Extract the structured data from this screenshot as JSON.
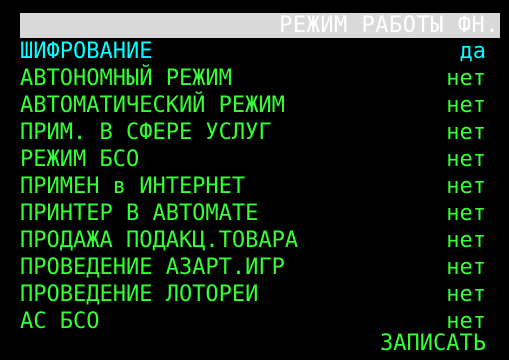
{
  "header": {
    "title": "РЕЖИМ РАБОТЫ ФН."
  },
  "menu": {
    "items": [
      {
        "label": "ШИФРОВАНИЕ",
        "value": "да",
        "selected": true
      },
      {
        "label": "АВТОНОМНЫЙ РЕЖИМ",
        "value": "нет",
        "selected": false
      },
      {
        "label": "АВТОМАТИЧЕСКИЙ РЕЖИМ",
        "value": "нет",
        "selected": false
      },
      {
        "label": "ПРИМ. В СФЕРЕ УСЛУГ",
        "value": "нет",
        "selected": false
      },
      {
        "label": "РЕЖИМ БСО",
        "value": "нет",
        "selected": false
      },
      {
        "label": "ПРИМЕН в ИНТЕРНЕТ",
        "value": "нет",
        "selected": false
      },
      {
        "label": "ПРИНТЕР В АВТОМАТЕ",
        "value": "нет",
        "selected": false
      },
      {
        "label": "ПРОДАЖА ПОДАКЦ.ТОВАРА",
        "value": "нет",
        "selected": false
      },
      {
        "label": "ПРОВЕДЕНИЕ АЗАРТ.ИГР",
        "value": "нет",
        "selected": false
      },
      {
        "label": "ПРОВЕДЕНИЕ ЛОТОРЕИ",
        "value": "нет",
        "selected": false
      },
      {
        "label": "АС БСО",
        "value": "нет",
        "selected": false
      }
    ]
  },
  "footer": {
    "save_label": "ЗАПИСАТЬ"
  },
  "colors": {
    "background": "#000000",
    "title_bar": "#d9d9d9",
    "title_text": "#ffffff",
    "selected_text": "#00ffff",
    "normal_text": "#33ff33"
  }
}
